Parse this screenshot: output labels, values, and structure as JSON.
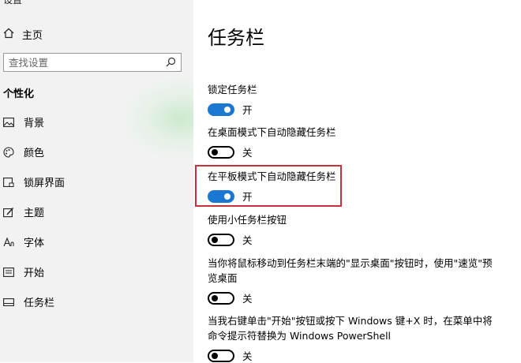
{
  "window": {
    "title": "设置"
  },
  "sidebar": {
    "home_label": "主页",
    "search_placeholder": "查找设置",
    "section_title": "个性化",
    "items": [
      {
        "label": "背景",
        "icon": "picture-icon"
      },
      {
        "label": "颜色",
        "icon": "palette-icon"
      },
      {
        "label": "锁屏界面",
        "icon": "lock-screen-icon"
      },
      {
        "label": "主题",
        "icon": "theme-icon"
      },
      {
        "label": "字体",
        "icon": "font-icon"
      },
      {
        "label": "开始",
        "icon": "start-icon"
      },
      {
        "label": "任务栏",
        "icon": "taskbar-icon"
      }
    ]
  },
  "main": {
    "title": "任务栏",
    "settings": [
      {
        "label": "锁定任务栏",
        "on": true,
        "state": "开"
      },
      {
        "label": "在桌面模式下自动隐藏任务栏",
        "on": false,
        "state": "关"
      },
      {
        "label": "在平板模式下自动隐藏任务栏",
        "on": true,
        "state": "开",
        "highlighted": true
      },
      {
        "label": "使用小任务栏按钮",
        "on": false,
        "state": "关"
      },
      {
        "label": "当你将鼠标移动到任务栏末端的\"显示桌面\"按钮时，使用\"速览\"预览桌面",
        "on": false,
        "state": "关"
      },
      {
        "label": "当我右键单击\"开始\"按钮或按下 Windows 键+X 时，在菜单中将命令提示符替换为 Windows PowerShell",
        "on": false,
        "state": "关"
      }
    ]
  },
  "colors": {
    "accent": "#1a78d2",
    "highlight_border": "#c9303b",
    "sidebar_bg": "#f2f2f2"
  }
}
